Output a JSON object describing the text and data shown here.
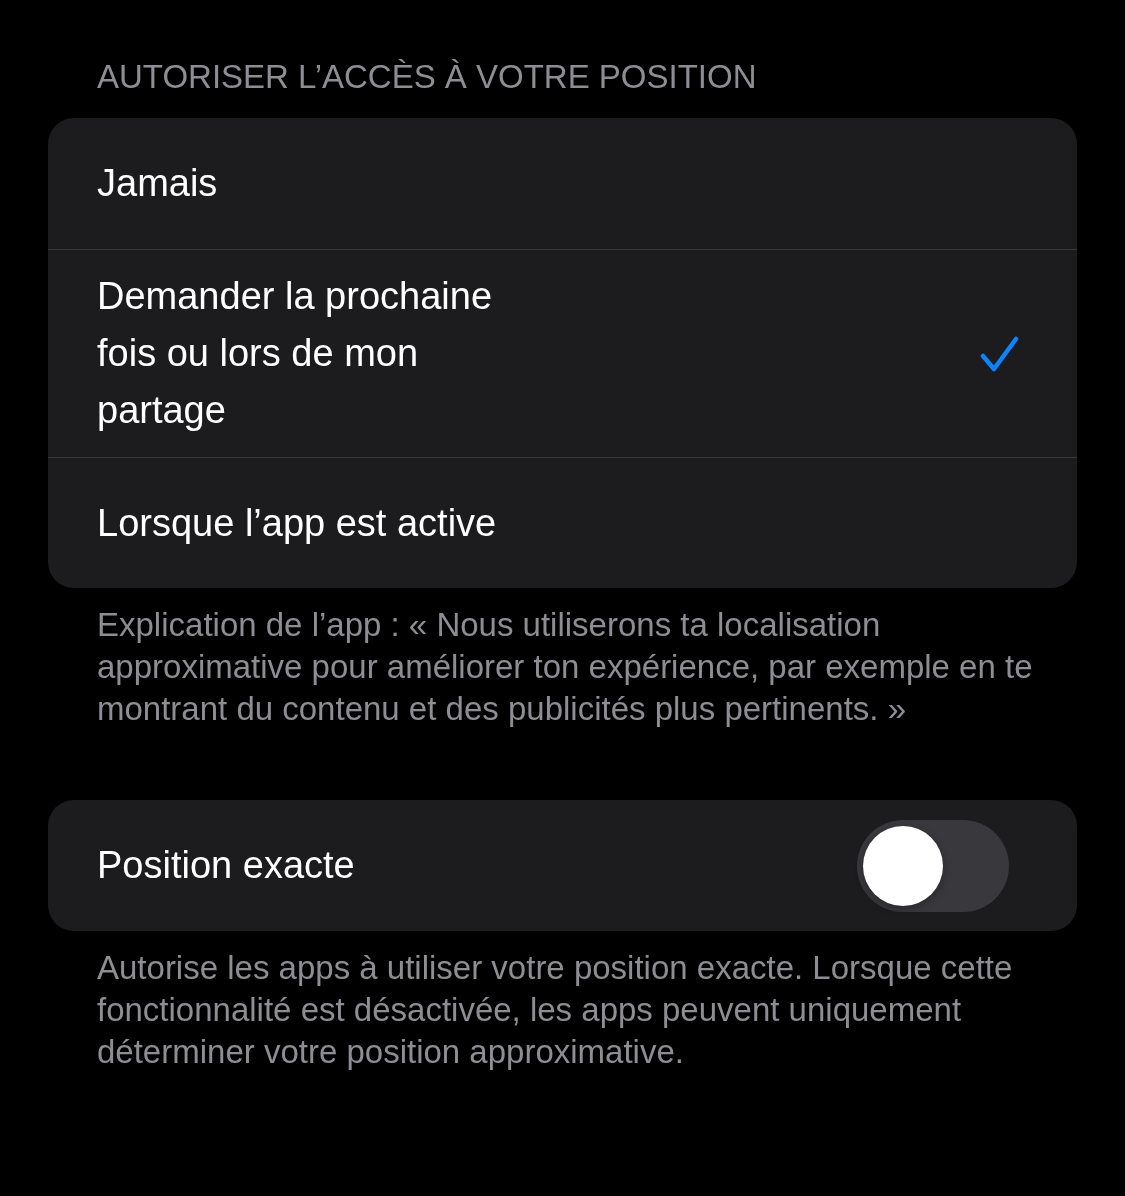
{
  "location_section": {
    "header": "AUTORISER L’ACCÈS À VOTRE POSITION",
    "options": [
      {
        "label": "Jamais",
        "selected": false
      },
      {
        "label": "Demander la prochaine fois ou lors de mon partage",
        "selected": true
      },
      {
        "label": "Lorsque l’app est active",
        "selected": false
      }
    ],
    "footer": "Explication de l’app : « Nous utiliserons ta localisation approximative pour améliorer ton expérience, par exemple en te montrant du contenu et des publicités plus pertinents. »"
  },
  "precise_section": {
    "label": "Position exacte",
    "on": false,
    "footer": "Autorise les apps à utiliser votre position exacte. Lorsque cette fonctionnalité est désactivée, les apps peuvent uniquement déterminer votre position approximative."
  }
}
